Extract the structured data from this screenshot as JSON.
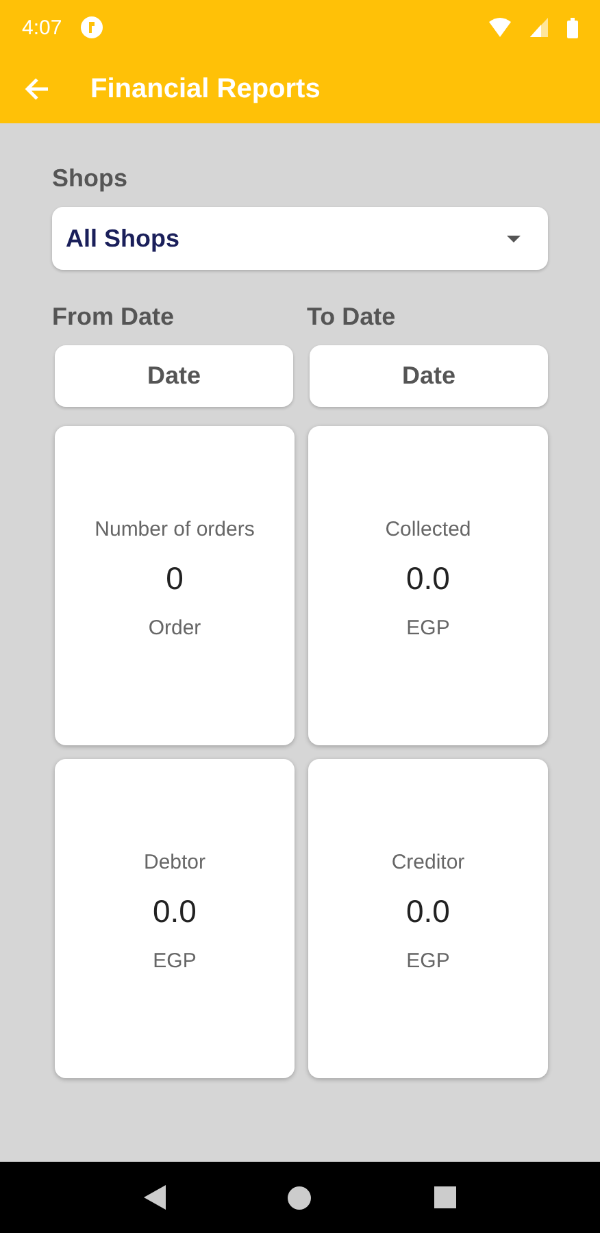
{
  "status_bar": {
    "time": "4:07"
  },
  "app_bar": {
    "title": "Financial Reports"
  },
  "shops": {
    "label": "Shops",
    "value": "All Shops"
  },
  "dates": [
    {
      "label": "From Date",
      "button": "Date"
    },
    {
      "label": "To Date",
      "button": "Date"
    }
  ],
  "cards": [
    {
      "label": "Number of orders",
      "value": "0",
      "unit": "Order"
    },
    {
      "label": "Collected",
      "value": "0.0",
      "unit": "EGP"
    },
    {
      "label": "Debtor",
      "value": "0.0",
      "unit": "EGP"
    },
    {
      "label": "Creditor",
      "value": "0.0",
      "unit": "EGP"
    }
  ]
}
